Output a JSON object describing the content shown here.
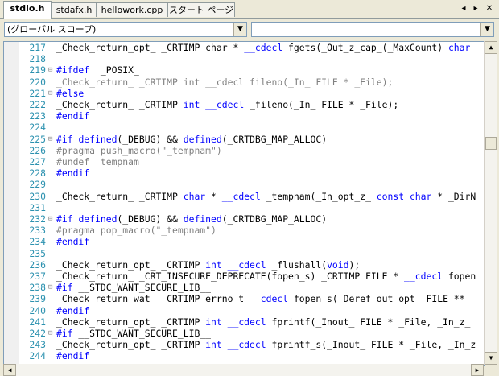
{
  "tabs": [
    {
      "label": "stdio.h",
      "active": true
    },
    {
      "label": "stdafx.h",
      "active": false
    },
    {
      "label": "hellowork.cpp",
      "active": false
    },
    {
      "label": "スタート ページ",
      "active": false
    }
  ],
  "tab_controls": {
    "prev": "◂",
    "next": "▸",
    "close": "✕"
  },
  "scope_combo": {
    "value": "(グローバル スコープ)"
  },
  "member_combo": {
    "value": ""
  },
  "lines": [
    {
      "n": "217",
      "g": "",
      "segs": [
        [
          "_Check_return_opt_ _CRTIMP ",
          ""
        ],
        [
          "char",
          ""
        ],
        [
          " * ",
          ""
        ],
        [
          "__cdecl",
          "kw"
        ],
        [
          " fgets(_Out_z_cap_(_MaxCount) ",
          ""
        ],
        [
          "char",
          "kw"
        ]
      ]
    },
    {
      "n": "218",
      "g": "",
      "segs": []
    },
    {
      "n": "219",
      "g": "⊟",
      "segs": [
        [
          "#ifdef",
          "kw"
        ],
        [
          "  _POSIX_",
          ""
        ]
      ]
    },
    {
      "n": "220",
      "g": "",
      "segs": [
        [
          "_Check_return_ _CRTIMP int __cdecl fileno(_In_ FILE * _File);",
          "dis"
        ]
      ]
    },
    {
      "n": "221",
      "g": "⊟",
      "segs": [
        [
          "#else",
          "kw"
        ]
      ]
    },
    {
      "n": "222",
      "g": "",
      "segs": [
        [
          "_Check_return_ _CRTIMP ",
          ""
        ],
        [
          "int",
          "kw"
        ],
        [
          " ",
          ""
        ],
        [
          "__cdecl",
          "kw"
        ],
        [
          " _fileno(_In_ FILE * _File);",
          ""
        ]
      ]
    },
    {
      "n": "223",
      "g": "",
      "segs": [
        [
          "#endif",
          "kw"
        ]
      ]
    },
    {
      "n": "224",
      "g": "",
      "segs": []
    },
    {
      "n": "225",
      "g": "⊟",
      "segs": [
        [
          "#if",
          "kw"
        ],
        [
          " ",
          ""
        ],
        [
          "defined",
          "kw"
        ],
        [
          "(_DEBUG) && ",
          ""
        ],
        [
          "defined",
          "kw"
        ],
        [
          "(_CRTDBG_MAP_ALLOC)",
          ""
        ]
      ]
    },
    {
      "n": "226",
      "g": "",
      "segs": [
        [
          "#pragma push_macro(\"_tempnam\")",
          "dis"
        ]
      ]
    },
    {
      "n": "227",
      "g": "",
      "segs": [
        [
          "#undef _tempnam",
          "dis"
        ]
      ]
    },
    {
      "n": "228",
      "g": "",
      "segs": [
        [
          "#endif",
          "kw"
        ]
      ]
    },
    {
      "n": "229",
      "g": "",
      "segs": []
    },
    {
      "n": "230",
      "g": "",
      "segs": [
        [
          "_Check_return_ _CRTIMP ",
          ""
        ],
        [
          "char",
          "kw"
        ],
        [
          " * ",
          ""
        ],
        [
          "__cdecl",
          "kw"
        ],
        [
          " _tempnam(_In_opt_z_ ",
          ""
        ],
        [
          "const",
          "kw"
        ],
        [
          " ",
          ""
        ],
        [
          "char",
          "kw"
        ],
        [
          " * _DirN",
          ""
        ]
      ]
    },
    {
      "n": "231",
      "g": "",
      "segs": []
    },
    {
      "n": "232",
      "g": "⊟",
      "segs": [
        [
          "#if",
          "kw"
        ],
        [
          " ",
          ""
        ],
        [
          "defined",
          "kw"
        ],
        [
          "(_DEBUG) && ",
          ""
        ],
        [
          "defined",
          "kw"
        ],
        [
          "(_CRTDBG_MAP_ALLOC)",
          ""
        ]
      ]
    },
    {
      "n": "233",
      "g": "",
      "segs": [
        [
          "#pragma pop_macro(\"_tempnam\")",
          "dis"
        ]
      ]
    },
    {
      "n": "234",
      "g": "",
      "segs": [
        [
          "#endif",
          "kw"
        ]
      ]
    },
    {
      "n": "235",
      "g": "",
      "segs": []
    },
    {
      "n": "236",
      "g": "",
      "segs": [
        [
          "_Check_return_opt_ _CRTIMP ",
          ""
        ],
        [
          "int",
          "kw"
        ],
        [
          " ",
          ""
        ],
        [
          "__cdecl",
          "kw"
        ],
        [
          " _flushall(",
          ""
        ],
        [
          "void",
          "kw"
        ],
        [
          ");",
          ""
        ]
      ]
    },
    {
      "n": "237",
      "g": "",
      "segs": [
        [
          "_Check_return_ _CRT_INSECURE_DEPRECATE(fopen_s) _CRTIMP FILE * ",
          ""
        ],
        [
          "__cdecl",
          "kw"
        ],
        [
          " fopen",
          ""
        ]
      ]
    },
    {
      "n": "238",
      "g": "⊟",
      "segs": [
        [
          "#if",
          "kw"
        ],
        [
          " __STDC_WANT_SECURE_LIB__",
          ""
        ]
      ]
    },
    {
      "n": "239",
      "g": "",
      "segs": [
        [
          "_Check_return_wat_ _CRTIMP errno_t ",
          ""
        ],
        [
          "__cdecl",
          "kw"
        ],
        [
          " fopen_s(_Deref_out_opt_ FILE ** _",
          ""
        ]
      ]
    },
    {
      "n": "240",
      "g": "",
      "segs": [
        [
          "#endif",
          "kw"
        ]
      ]
    },
    {
      "n": "241",
      "g": "",
      "segs": [
        [
          "_Check_return_opt_ _CRTIMP ",
          ""
        ],
        [
          "int",
          "kw"
        ],
        [
          " ",
          ""
        ],
        [
          "__cdecl",
          "kw"
        ],
        [
          " fprintf(_Inout_ FILE * _File, _In_z_",
          ""
        ]
      ]
    },
    {
      "n": "242",
      "g": "⊟",
      "segs": [
        [
          "#if",
          "kw"
        ],
        [
          " __STDC_WANT_SECURE_LIB__",
          ""
        ]
      ]
    },
    {
      "n": "243",
      "g": "",
      "segs": [
        [
          "_Check_return_opt_ _CRTIMP ",
          ""
        ],
        [
          "int",
          "kw"
        ],
        [
          " ",
          ""
        ],
        [
          "__cdecl",
          "kw"
        ],
        [
          " fprintf_s(_Inout_ FILE * _File, _In_z",
          ""
        ]
      ]
    },
    {
      "n": "244",
      "g": "",
      "segs": [
        [
          "#endif",
          "kw"
        ]
      ]
    }
  ],
  "colors": {
    "keyword": "#0000ff",
    "line_number": "#2b91af",
    "disabled": "#808080"
  }
}
